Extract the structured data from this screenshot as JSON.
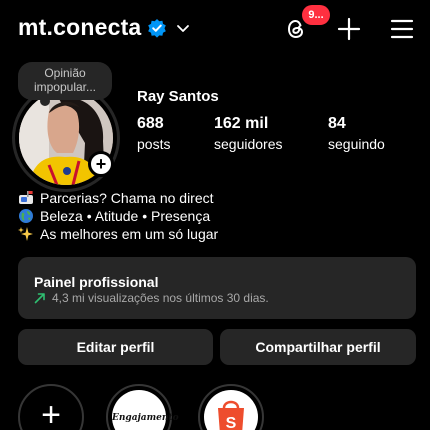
{
  "header": {
    "username": "mt.conecta",
    "notification_count": "9...",
    "icons": {
      "verified": "verified-badge-icon",
      "switch": "chevron-down-icon",
      "threads": "threads-icon",
      "create": "plus-icon",
      "menu": "hamburger-menu-icon"
    }
  },
  "profile": {
    "note": "Opinião impopular...",
    "display_name": "Ray Santos",
    "stats": [
      {
        "value": "688",
        "label": "posts"
      },
      {
        "value": "162 mil",
        "label": "seguidores"
      },
      {
        "value": "84",
        "label": "seguindo"
      }
    ],
    "bio": [
      {
        "icon": "mailbox-emoji",
        "text": "Parcerias? Chama no direct"
      },
      {
        "icon": "globe-emoji",
        "text": "Beleza • Atitude • Presença"
      },
      {
        "icon": "sparkles-emoji",
        "text": "As melhores em um só lugar"
      }
    ]
  },
  "dashboard": {
    "title": "Painel profissional",
    "subtitle": "4,3 mi visualizações nos últimos 30 dias."
  },
  "actions": {
    "edit_label": "Editar perfil",
    "share_label": "Compartilhar perfil"
  },
  "highlights": [
    {
      "icon": "plus-icon",
      "text": ""
    },
    {
      "icon": "",
      "text": "Engajamento"
    },
    {
      "icon": "shopee-bag-icon",
      "text": ""
    }
  ],
  "colors": {
    "background": "#000000",
    "surface": "#262626",
    "accent": "#0095f6",
    "badge": "#ff3040",
    "trend": "#2fbf71"
  }
}
